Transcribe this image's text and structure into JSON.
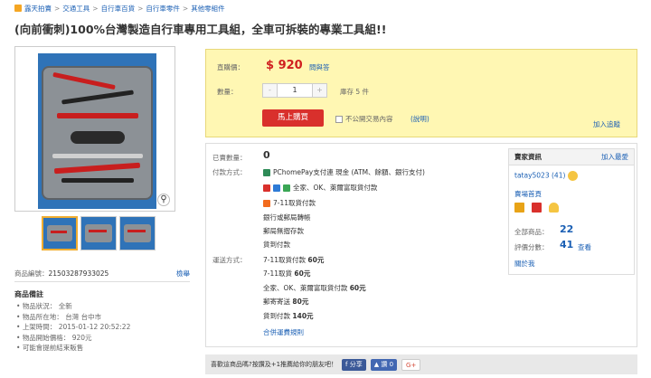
{
  "breadcrumb": [
    "露天拍賣",
    "交通工具",
    "自行車百貨",
    "自行車零件",
    "其他零組件"
  ],
  "title": "(向前衝刺)100%台灣製造自行車專用工具組，全車可拆裝的專業工具組!!",
  "product_id": {
    "label": "商品編號：",
    "value": "21503287933025",
    "report": "檢舉"
  },
  "notes": {
    "title": "商品備註",
    "items": [
      "物品狀況： 全新",
      "物品所在地： 台灣 台中市",
      "上架時間： 2015-01-12 20:52:22",
      "物品開始價格： 920元",
      "可能會提前結束販售"
    ]
  },
  "buy": {
    "price_label": "直購價：",
    "currency": "$",
    "price": "920",
    "ask_link": "問與答",
    "qty_label": "數量：",
    "qty_minus": "-",
    "qty_value": "1",
    "qty_plus": "+",
    "stock": "庫存 5 件",
    "buy_button": "馬上購買",
    "private_label": "不公開交易內容",
    "explain_link": "(說明)",
    "track_link": "加入追蹤"
  },
  "info": {
    "sold_label": "已賣數量：",
    "sold_value": "0",
    "pay_label": "付款方式：",
    "pay_methods": [
      "PChomePay支付連 現金 (ATM、餘額、銀行支付)",
      "全家、OK、萊爾富取貨付款",
      "7-11取貨付款",
      "銀行或郵局轉帳",
      "郵局無摺存款",
      "貨到付款"
    ],
    "ship_label": "運送方式：",
    "shipping": [
      {
        "name": "7-11取貨付款 ",
        "price": "60元"
      },
      {
        "name": "7-11取貨 ",
        "price": "60元"
      },
      {
        "name": "全家、OK、萊爾富取貨付款 ",
        "price": "60元"
      },
      {
        "name": "郵寄寄送 ",
        "price": "80元"
      },
      {
        "name": "貨到付款 ",
        "price": "140元"
      }
    ],
    "ship_rules": "合併運費規則"
  },
  "seller": {
    "header": "賣家資訊",
    "add_fav": "加入最愛",
    "name": "tatay5023",
    "score": "(41)",
    "store_link": "賣場首頁",
    "all_items_label": "全部商品：",
    "all_items": "22",
    "rating_label": "評價分數：",
    "rating": "41",
    "view_link": "查看",
    "about_link": "關於我"
  },
  "share": {
    "text": "喜歡這商品嗎?按讚及+1推薦給你的朋友吧！",
    "share_btn": "分享",
    "like_btn": "讚 0",
    "gplus": "G+"
  },
  "colors": {
    "accent": "#d9302c",
    "link": "#1a5fb4",
    "buybox_bg": "#fff7b3",
    "facebook": "#3b5998"
  }
}
